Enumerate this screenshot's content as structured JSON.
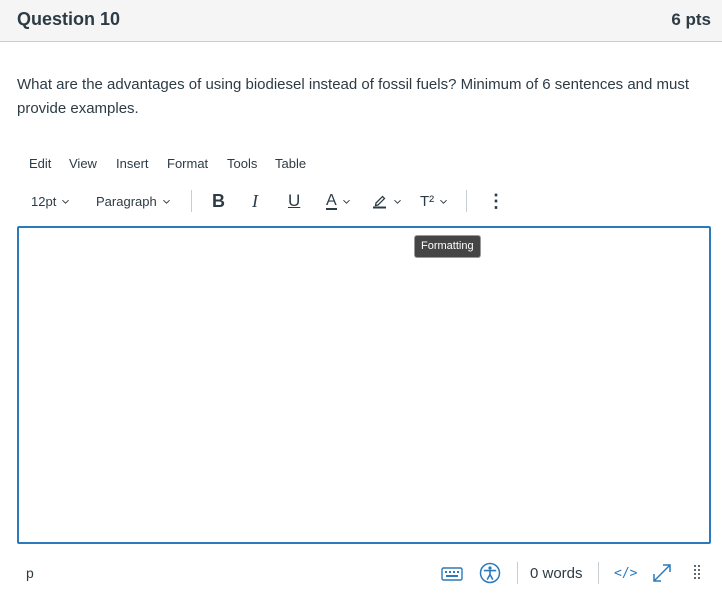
{
  "header": {
    "title": "Question 10",
    "points": "6 pts"
  },
  "question": {
    "text": "What are the advantages of using biodiesel instead of fossil fuels?  Minimum of 6 sentences and must provide examples."
  },
  "menubar": {
    "items": [
      "Edit",
      "View",
      "Insert",
      "Format",
      "Tools",
      "Table"
    ]
  },
  "toolbar": {
    "font_size": "12pt",
    "block_format": "Paragraph",
    "bold_label": "B",
    "italic_label": "I",
    "underline_label": "U",
    "text_color_label": "A",
    "superscript_label": "T²",
    "more_label": "⋮",
    "tooltip": "Formatting"
  },
  "editor": {
    "content": ""
  },
  "statusbar": {
    "element_path": "p",
    "word_count": "0 words",
    "html_toggle": "</>"
  },
  "colors": {
    "accent": "#2b7abc",
    "text": "#2d3b45",
    "header_bg": "#f5f5f5",
    "border": "#c7cdd1"
  }
}
